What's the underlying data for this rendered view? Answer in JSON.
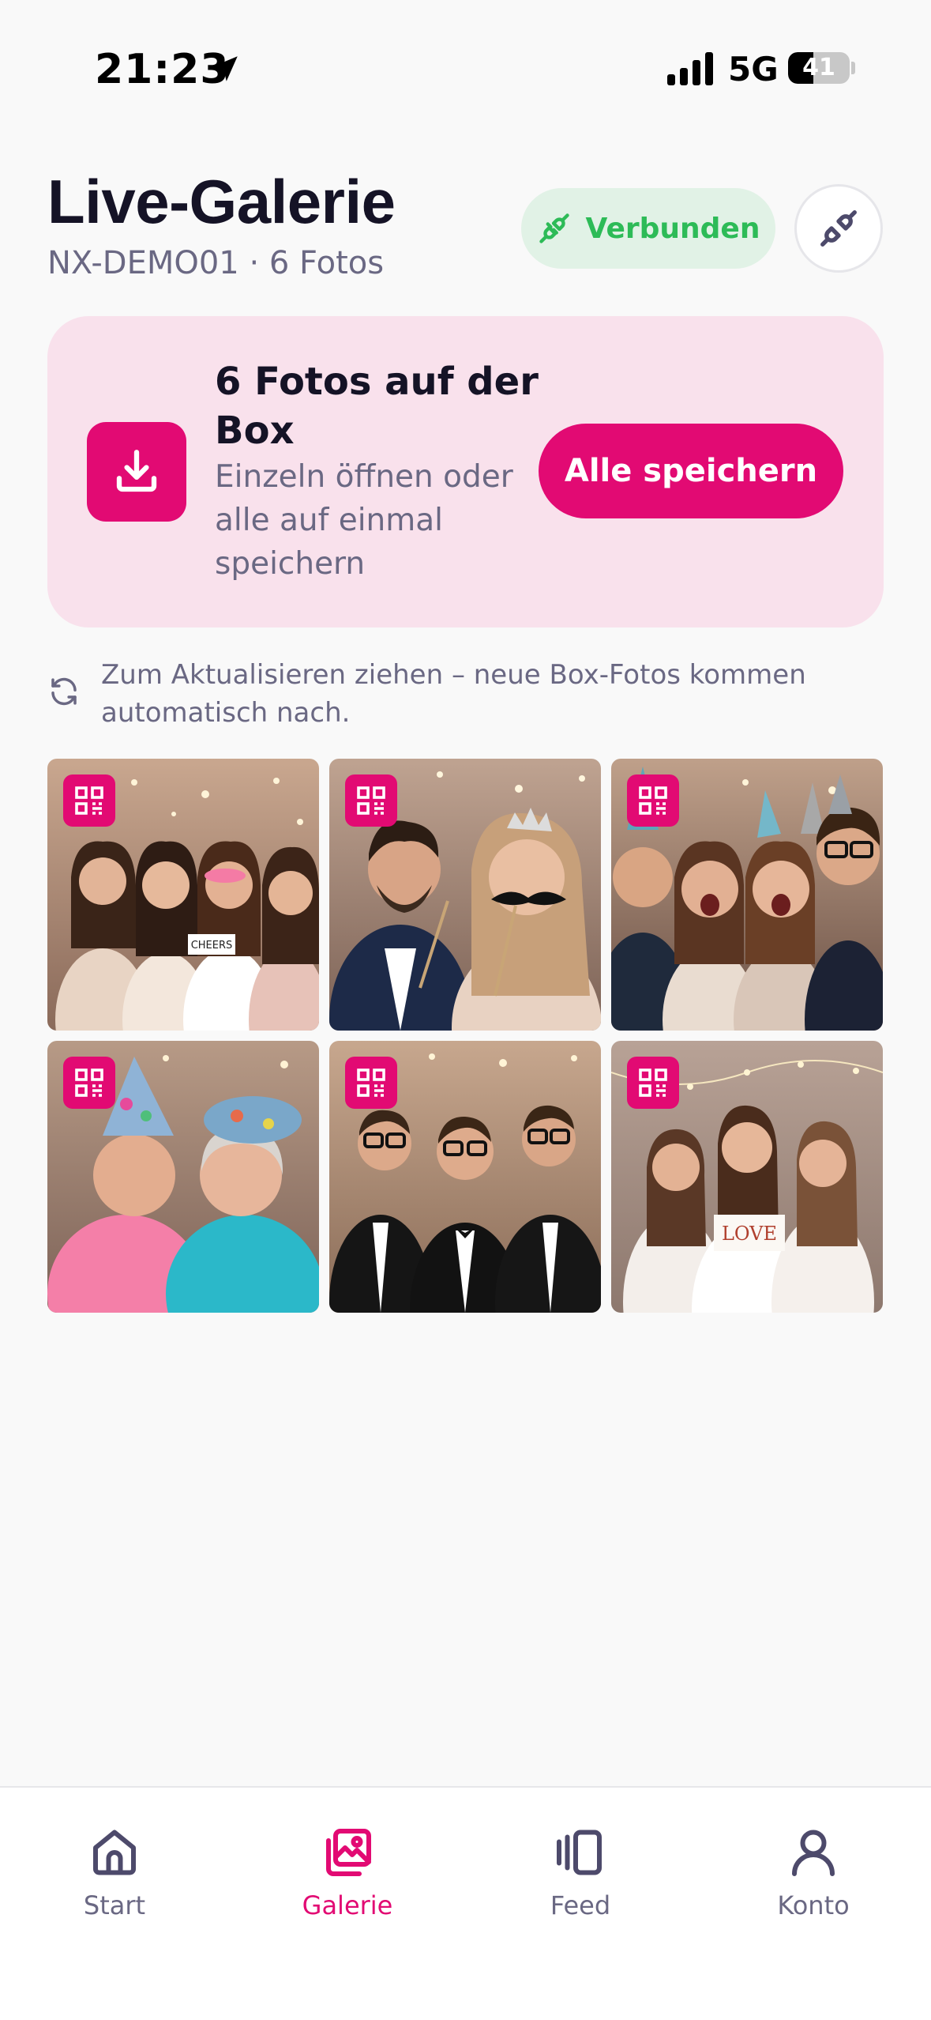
{
  "status_bar": {
    "time": "21:23",
    "network": "5G",
    "battery_percent": 41,
    "battery_label": "41",
    "icons": [
      "location-arrow-icon",
      "signal-bars-icon",
      "battery-icon"
    ]
  },
  "header": {
    "title": "Live-Galerie",
    "subtitle": "NX-DEMO01 · 6 Fotos",
    "connection_status": "Verbunden",
    "connection_icon": "plug-connected-icon",
    "disconnect_icon": "plug-disconnect-icon"
  },
  "save_card": {
    "icon": "download-icon",
    "title": "6 Fotos auf der Box",
    "text": "Einzeln öffnen oder alle auf einmal speichern",
    "button_label": "Alle speichern"
  },
  "refresh_hint": {
    "icon": "refresh-icon",
    "text": "Zum Aktualisieren ziehen – neue Box-Fotos kommen automatisch nach."
  },
  "photos": [
    {
      "badge_icon": "qr-code-icon",
      "scene": "group of women with champagne glasses",
      "sign": "CHEERS"
    },
    {
      "badge_icon": "qr-code-icon",
      "scene": "couple with mustache prop and tiara",
      "sign": ""
    },
    {
      "badge_icon": "qr-code-icon",
      "scene": "friends with party hats",
      "sign": ""
    },
    {
      "badge_icon": "qr-code-icon",
      "scene": "two older ladies with party hats and boas",
      "sign": ""
    },
    {
      "badge_icon": "qr-code-icon",
      "scene": "three men in tuxedos with glasses",
      "sign": ""
    },
    {
      "badge_icon": "qr-code-icon",
      "scene": "bride with friends holding sign",
      "sign": "LOVE"
    }
  ],
  "tab_bar": {
    "items": [
      {
        "label": "Start",
        "icon": "home-icon",
        "active": false
      },
      {
        "label": "Galerie",
        "icon": "gallery-icon",
        "active": true
      },
      {
        "label": "Feed",
        "icon": "feed-cards-icon",
        "active": false
      },
      {
        "label": "Konto",
        "icon": "user-icon",
        "active": false
      }
    ]
  },
  "colors": {
    "accent": "#e20a73",
    "accent_soft": "#f9e1ec",
    "success": "#2dbb57",
    "success_soft": "#e1f2e6",
    "text": "#151326",
    "muted": "#6a6883",
    "background": "#f9f9f9"
  }
}
